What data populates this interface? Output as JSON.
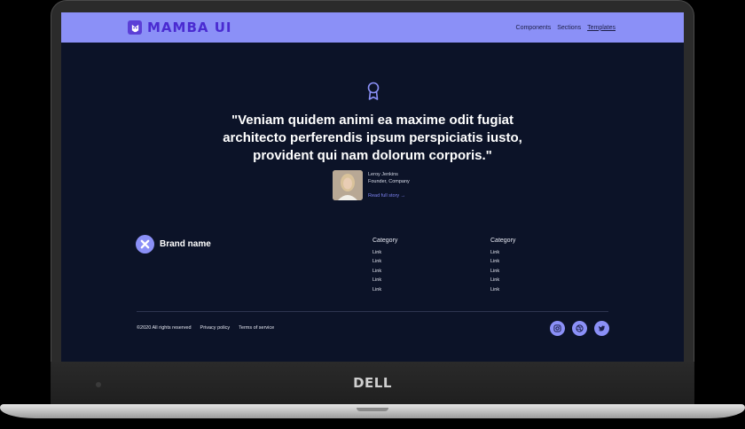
{
  "device": {
    "brand": "DELL"
  },
  "nav": {
    "logo_text": "MAMBA UI",
    "links": [
      {
        "label": "Components",
        "active": false
      },
      {
        "label": "Sections",
        "active": false
      },
      {
        "label": "Templates",
        "active": true
      }
    ]
  },
  "testimonial": {
    "quote": "\"Veniam quidem animi ea maxime odit fugiat architecto perferendis ipsum perspiciatis iusto, provident qui nam dolorum corporis.\"",
    "author_name": "Leroy Jenkins",
    "author_role": "Founder, Company",
    "link_label": "Read full story →"
  },
  "footer": {
    "brand_name": "Brand name",
    "columns": [
      {
        "title": "Category",
        "links": [
          "Link",
          "Link",
          "Link",
          "Link",
          "Link"
        ]
      },
      {
        "title": "Category",
        "links": [
          "Link",
          "Link",
          "Link",
          "Link",
          "Link"
        ]
      }
    ],
    "copyright": "©2020 All rights reserved",
    "privacy": "Privacy policy",
    "terms": "Terms of service",
    "socials": [
      "instagram-icon",
      "dribbble-icon",
      "twitter-icon"
    ]
  },
  "colors": {
    "accent": "#8b90f7",
    "background": "#0c1328",
    "logo": "#4a2bd1"
  }
}
